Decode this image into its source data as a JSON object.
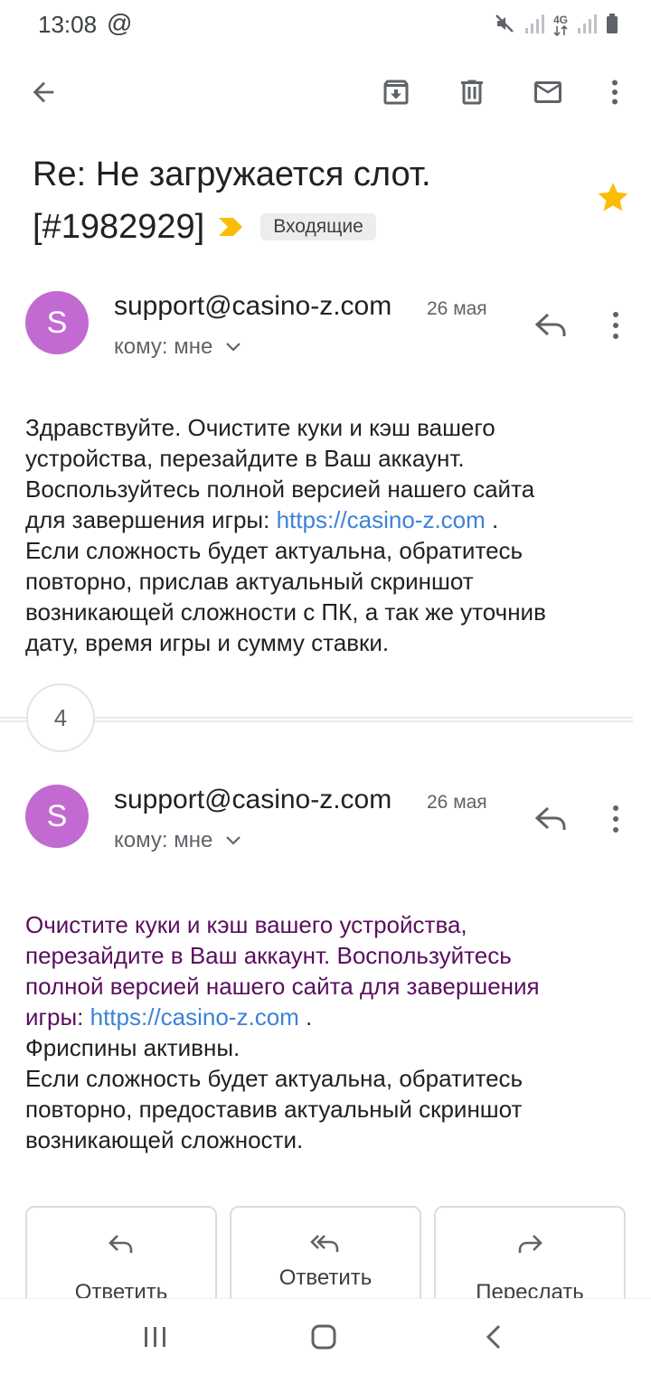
{
  "status_bar": {
    "time": "13:08",
    "at_symbol": "@",
    "network": "4G",
    "icons": [
      "mute-icon",
      "signal-icon",
      "data-icon",
      "signal-icon",
      "battery-icon"
    ]
  },
  "toolbar": {
    "icons": [
      "back-arrow-icon",
      "archive-icon",
      "delete-icon",
      "mark-unread-icon",
      "more-vert-icon"
    ]
  },
  "subject": {
    "line1": "Re: Не загружается слот.",
    "line2": "[#1982929]",
    "label": "Входящие",
    "important_color": "#fbbc04",
    "star_color": "#fbbc04"
  },
  "messages": [
    {
      "avatar_letter": "S",
      "avatar_color": "#c26ad1",
      "sender": "support@casino-z.com",
      "date": "26 мая",
      "recipient": "кому: мне",
      "body_lines": [
        "Здравствуйте. Очистите куки и кэш вашего",
        "устройства, перезайдите в Ваш аккаунт.",
        "Воспользуйтесь полной версией нашего сайта",
        "для завершения игры:",
        "Если сложность будет актуальна, обратитесь",
        "повторно, прислав актуальный скриншот",
        "возникающей сложности с ПК, а так же уточнив",
        "дату, время игры и сумму ставки."
      ],
      "link": "https://casino-z.com",
      "after_link": " ."
    },
    {
      "avatar_letter": "S",
      "avatar_color": "#c26ad1",
      "sender": "support@casino-z.com",
      "date": "26 мая",
      "recipient": "кому: мне",
      "quoted_lines": [
        "Очистите куки и кэш вашего устройства,",
        "перезайдите в Ваш аккаунт. Воспользуйтесь",
        "полной версией нашего сайта для завершения",
        "игры:"
      ],
      "link": "https://casino-z.com",
      "after_link": " .",
      "body_lines": [
        "Фриспины активны.",
        "Если сложность будет актуальна, обратитесь",
        "повторно, предоставив актуальный скриншот",
        "возникающей сложности."
      ]
    }
  ],
  "collapsed_count": "4",
  "actions": {
    "reply": "Ответить",
    "reply_all": "Ответить",
    "forward": "Переслать"
  },
  "navbar": {
    "icons": [
      "recents-icon",
      "home-icon",
      "back-icon"
    ]
  }
}
